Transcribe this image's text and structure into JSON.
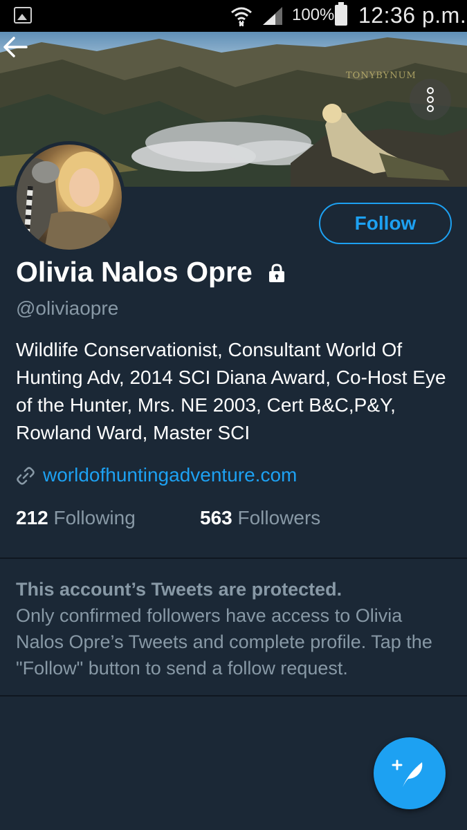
{
  "status_bar": {
    "battery_percent": "100%",
    "time": "12:36 p.m."
  },
  "header": {
    "watermark": "TONYBYNUM"
  },
  "profile": {
    "follow_label": "Follow",
    "name": "Olivia Nalos Opre",
    "handle": "@oliviaopre",
    "bio": "Wildlife Conservationist, Consultant World Of Hunting Adv, 2014 SCI Diana Award, Co-Host Eye of the Hunter, Mrs. NE 2003, Cert B&C,P&Y, Rowland Ward, Master SCI",
    "website": "worldofhuntingadventure.com",
    "following_count": "212",
    "following_label": "Following",
    "followers_count": "563",
    "followers_label": "Followers"
  },
  "protected_notice": {
    "title": "This account’s Tweets are protected.",
    "body": "Only confirmed followers have access to Olivia Nalos Opre’s Tweets and complete profile. Tap the \"Follow\" button to send a follow request."
  },
  "colors": {
    "background": "#1b2836",
    "accent": "#1da1f2",
    "muted_text": "#8899a6"
  }
}
